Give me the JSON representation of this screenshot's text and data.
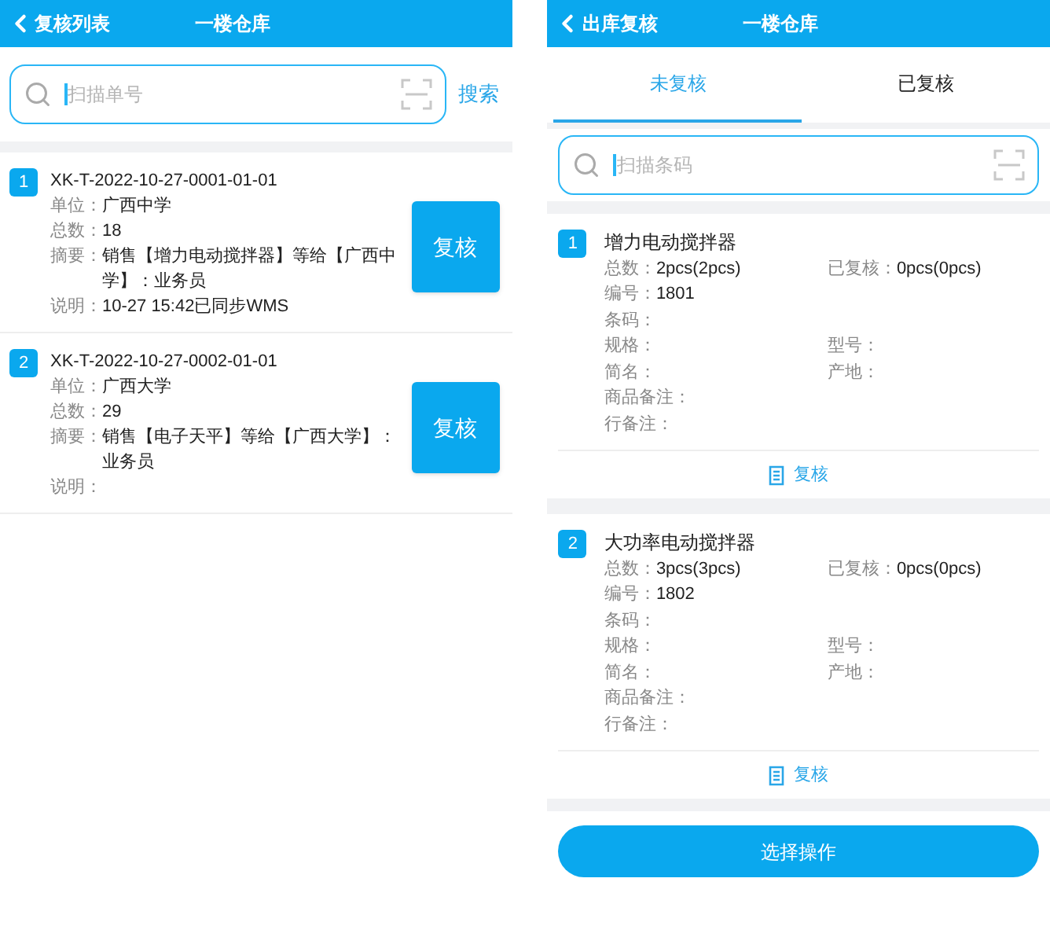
{
  "left_screen": {
    "header": {
      "back": "复核列表",
      "title": "一楼仓库"
    },
    "search": {
      "placeholder": "扫描单号",
      "button": "搜索"
    },
    "orders": [
      {
        "index": "1",
        "number": "XK-T-2022-10-27-0001-01-01",
        "fields": [
          {
            "label": "单位：",
            "value": "广西中学"
          },
          {
            "label": "总数：",
            "value": "18"
          },
          {
            "label": "摘要：",
            "value": "销售【增力电动搅拌器】等给【广西中学】：业务员"
          },
          {
            "label": "说明：",
            "value": "10-27 15:42已同步WMS"
          }
        ],
        "action": "复核"
      },
      {
        "index": "2",
        "number": "XK-T-2022-10-27-0002-01-01",
        "fields": [
          {
            "label": "单位：",
            "value": "广西大学"
          },
          {
            "label": "总数：",
            "value": "29"
          },
          {
            "label": "摘要：",
            "value": "销售【电子天平】等给【广西大学】：业务员"
          },
          {
            "label": "说明："
          }
        ],
        "action": "复核"
      }
    ]
  },
  "right_screen": {
    "header": {
      "back": "出库复核",
      "title": "一楼仓库"
    },
    "tabs": [
      {
        "label": "未复核",
        "selected": true
      },
      {
        "label": "已复核",
        "selected": false
      }
    ],
    "search": {
      "placeholder": "扫描条码"
    },
    "items": [
      {
        "index": "1",
        "name": "增力电动搅拌器",
        "rows": [
          [
            {
              "label": "总数：",
              "value": "2pcs(2pcs)"
            },
            {
              "label": "已复核：",
              "value": "0pcs(0pcs)"
            }
          ],
          [
            {
              "label": "编号：",
              "value": "1801"
            }
          ],
          [
            {
              "label": "条码："
            }
          ],
          [
            {
              "label": "规格："
            },
            {
              "label": "型号："
            }
          ],
          [
            {
              "label": "简名："
            },
            {
              "label": "产地："
            }
          ],
          [
            {
              "label": "商品备注："
            }
          ],
          [
            {
              "label": "行备注："
            }
          ]
        ],
        "action": "复核"
      },
      {
        "index": "2",
        "name": "大功率电动搅拌器",
        "rows": [
          [
            {
              "label": "总数：",
              "value": "3pcs(3pcs)"
            },
            {
              "label": "已复核：",
              "value": "0pcs(0pcs)"
            }
          ],
          [
            {
              "label": "编号：",
              "value": "1802"
            }
          ],
          [
            {
              "label": "条码："
            }
          ],
          [
            {
              "label": "规格："
            },
            {
              "label": "型号："
            }
          ],
          [
            {
              "label": "简名："
            },
            {
              "label": "产地："
            }
          ],
          [
            {
              "label": "商品备注："
            }
          ],
          [
            {
              "label": "行备注："
            }
          ]
        ],
        "action": "复核"
      }
    ],
    "bottom_button": "选择操作"
  }
}
